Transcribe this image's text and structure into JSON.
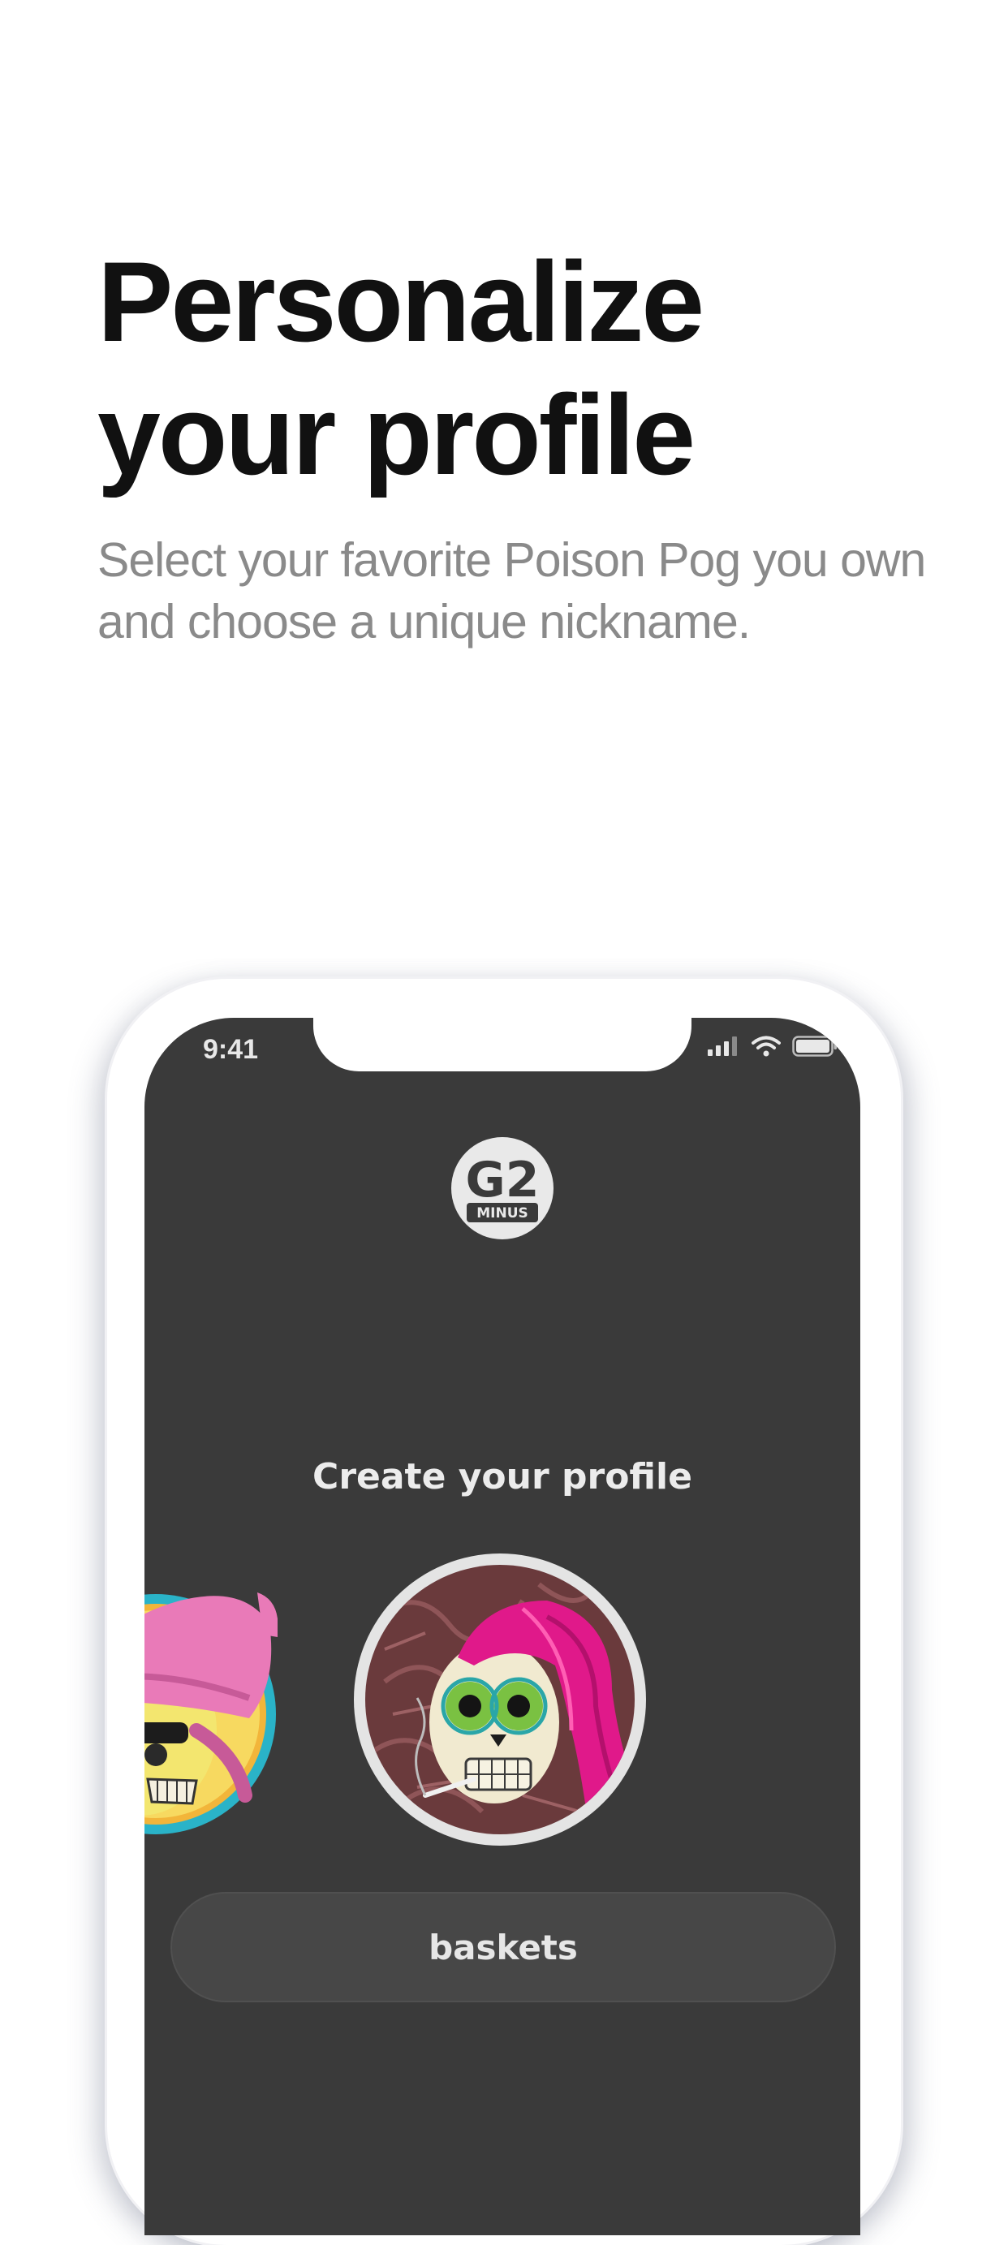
{
  "hero": {
    "title": "Personalize\nyour profile",
    "subtitle": "Select your favorite Poison Pog you own and choose a unique nickname."
  },
  "phone": {
    "status_bar": {
      "time": "9:41",
      "icons": [
        "cellular-signal-icon",
        "wifi-icon",
        "battery-icon"
      ]
    },
    "app": {
      "logo_text": "G2",
      "logo_subtext": "MINUS",
      "screen_title": "Create your profile",
      "avatars": [
        "skull-pink-beanie-avatar",
        "skull-pink-hair-avatar"
      ],
      "nickname": "baskets"
    }
  },
  "colors": {
    "screen_bg": "#3a3a3a",
    "input_bg": "#474747",
    "accent_pink": "#e0198a"
  }
}
